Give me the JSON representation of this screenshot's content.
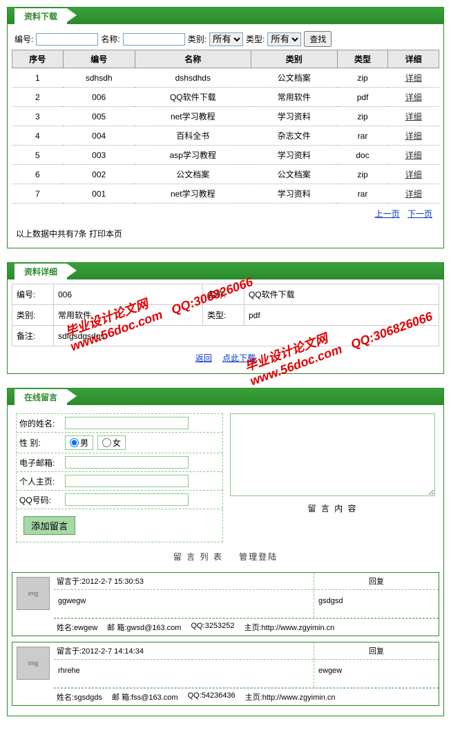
{
  "download": {
    "title": "资料下载",
    "search": {
      "id_label": "编号:",
      "name_label": "名称:",
      "cat_label": "类别:",
      "type_label": "类型:",
      "cat_value": "所有",
      "type_value": "所有",
      "btn": "查找"
    },
    "headers": [
      "序号",
      "编号",
      "名称",
      "类别",
      "类型",
      "详细"
    ],
    "rows": [
      {
        "idx": "1",
        "id": "sdhsdh",
        "name": "dshsdhds",
        "cat": "公文档案",
        "type": "zip",
        "link": "详细"
      },
      {
        "idx": "2",
        "id": "006",
        "name": "QQ软件下载",
        "cat": "常用软件",
        "type": "pdf",
        "link": "详细"
      },
      {
        "idx": "3",
        "id": "005",
        "name": "net学习教程",
        "cat": "学习资料",
        "type": "zip",
        "link": "详细"
      },
      {
        "idx": "4",
        "id": "004",
        "name": "百科全书",
        "cat": "杂志文件",
        "type": "rar",
        "link": "详细"
      },
      {
        "idx": "5",
        "id": "003",
        "name": "asp学习教程",
        "cat": "学习资料",
        "type": "doc",
        "link": "详细"
      },
      {
        "idx": "6",
        "id": "002",
        "name": "公文档案",
        "cat": "公文档案",
        "type": "zip",
        "link": "详细"
      },
      {
        "idx": "7",
        "id": "001",
        "name": "net学习教程",
        "cat": "学习资料",
        "type": "rar",
        "link": "详细"
      }
    ],
    "pager": {
      "prev": "上一页",
      "next": "下一页"
    },
    "summary": "以上数据中共有7条 打印本页"
  },
  "detail": {
    "title": "资料详细",
    "rows": [
      {
        "l1": "编号:",
        "v1": "006",
        "l2": "名称:",
        "v2": "QQ软件下载"
      },
      {
        "l1": "类别:",
        "v1": "常用软件",
        "l2": "类型:",
        "v2": "pdf"
      },
      {
        "l1": "备注:",
        "v1": "sdfgsdgsdgs",
        "l2": "",
        "v2": ""
      }
    ],
    "back": "返回",
    "dl": "点此下载"
  },
  "watermark": {
    "text1": "毕业设计论文网",
    "text2": "www.56doc.com",
    "text3": "QQ:306826066"
  },
  "guestbook": {
    "title": "在线留言",
    "name_label": "你的姓名:",
    "gender_label": "性 别:",
    "gender_m": "男",
    "gender_f": "女",
    "email_label": "电子邮箱:",
    "homepage_label": "个人主页:",
    "qq_label": "QQ号码:",
    "add_btn": "添加留言",
    "content_label": "留 言 内 容",
    "list_label": "留 言 列 表",
    "admin_label": "管理登陆",
    "messages": [
      {
        "time": "留言于:2012-2-7 15:30:53",
        "reply_label": "回复",
        "content": "ggwegw",
        "reply": "gsdgsd",
        "footer_name": "姓名:ewgew",
        "footer_email": "邮 箱:gwsd@163.com",
        "footer_qq": "QQ:3253252",
        "footer_home": "主页:http://www.zgyimin.cn"
      },
      {
        "time": "留言于:2012-2-7 14:14:34",
        "reply_label": "回复",
        "content": "rhrehe",
        "reply": "ewgew",
        "footer_name": "姓名:sgsdgds",
        "footer_email": "邮 箱:fss@163.com",
        "footer_qq": "QQ:54236436",
        "footer_home": "主页:http://www.zgyimin.cn"
      }
    ]
  }
}
